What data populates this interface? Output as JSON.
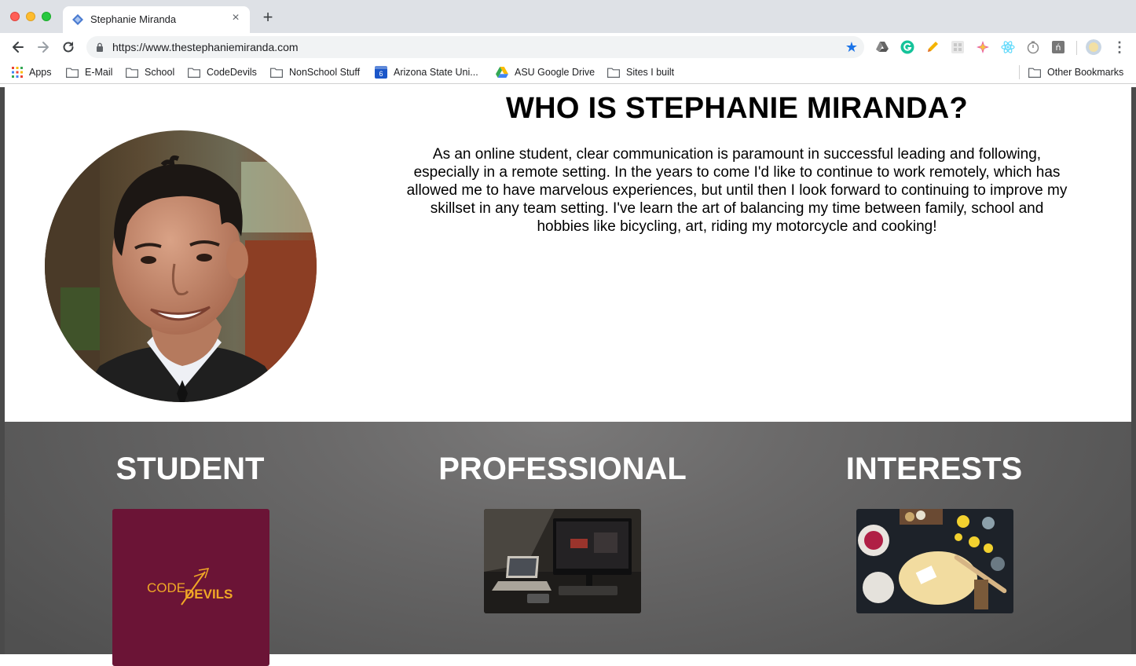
{
  "browser": {
    "tab_title": "Stephanie Miranda",
    "tab_close": "×",
    "new_tab": "+",
    "url": "https://www.thestephaniemiranda.com",
    "star": "★",
    "menu": "⋮",
    "bookmarks": [
      {
        "label": "Apps",
        "icon": "apps-grid-icon"
      },
      {
        "label": "E-Mail",
        "icon": "folder-icon"
      },
      {
        "label": "School",
        "icon": "folder-icon"
      },
      {
        "label": "CodeDevils",
        "icon": "folder-icon"
      },
      {
        "label": "NonSchool Stuff",
        "icon": "folder-icon"
      },
      {
        "label": "Arizona State Uni...",
        "icon": "calendar-icon"
      },
      {
        "label": "ASU Google Drive",
        "icon": "google-drive-icon"
      },
      {
        "label": "Sites I built",
        "icon": "folder-icon"
      },
      {
        "label": "Other Bookmarks",
        "icon": "folder-icon"
      }
    ],
    "calendar_day": "6"
  },
  "about": {
    "title": "WHO IS STEPHANIE MIRANDA?",
    "text": "As an online student, clear communication is paramount in successful leading and following, especially in a remote setting. In the years to come I'd like to continue to work remotely, which has allowed me to have marvelous experiences, but until then I look forward to continuing to improve my skillset in any team setting. I've learn the art of balancing my time between family, school and hobbies like bicycling, art, riding my motorcycle and cooking!"
  },
  "sections": [
    {
      "title": "STUDENT",
      "image": "codedevils-logo"
    },
    {
      "title": "PROFESSIONAL",
      "image": "desk-laptop-photo"
    },
    {
      "title": "INTERESTS",
      "image": "cooking-photo"
    }
  ],
  "codedevils_logo": {
    "word1": "CODE",
    "word2": "DEVILS",
    "bg_color": "#6b1436",
    "text_color": "#f0a826"
  },
  "colors": {
    "accent_blue": "#1a73e8",
    "page_gray": "#6a6969"
  }
}
